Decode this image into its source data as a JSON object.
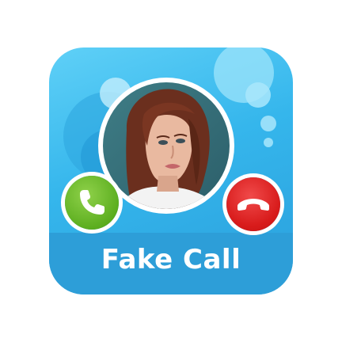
{
  "app": {
    "title": "Fake Call",
    "colors": {
      "background": "#35b6ec",
      "banner": "#2d9ed8",
      "accept": "#5cae1f",
      "decline": "#d81b1b",
      "title_text": "#ffffff"
    }
  },
  "icons": {
    "accept": "phone-accept-icon",
    "decline": "phone-decline-icon"
  }
}
